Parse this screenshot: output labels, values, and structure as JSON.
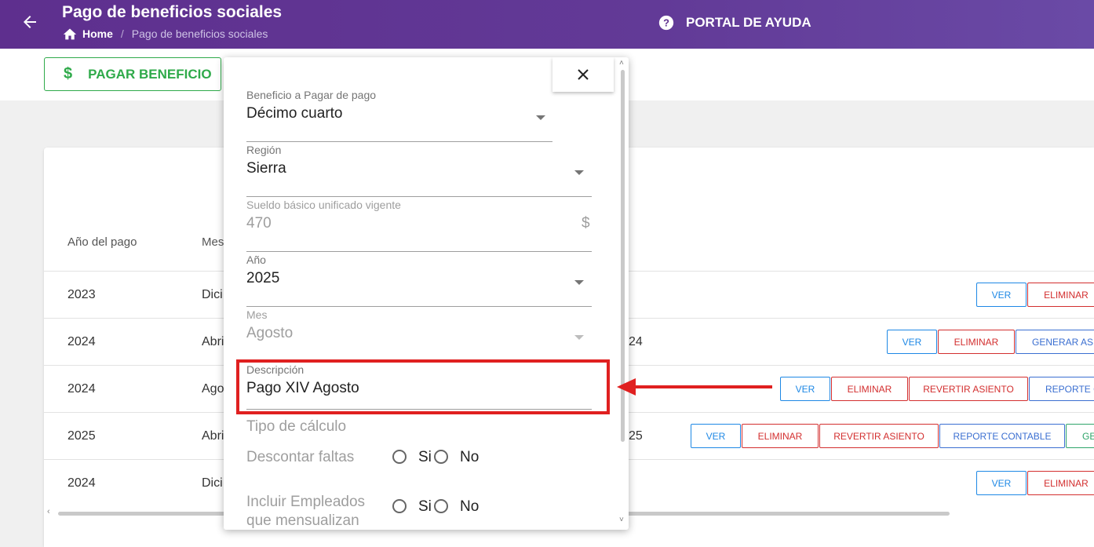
{
  "header": {
    "title": "Pago de beneficios sociales",
    "breadcrumb": {
      "home": "Home",
      "separator": "/",
      "current": "Pago de beneficios sociales"
    },
    "help_label": "PORTAL DE AYUDA"
  },
  "toolbar": {
    "pay_button": "PAGAR BENEFICIO",
    "pay_icon": "$"
  },
  "table": {
    "headers": {
      "year": "Año del pago",
      "month": "Mes"
    },
    "rows": [
      {
        "year": "2023",
        "month": "Dici",
        "extra": "",
        "actions": [
          "VER",
          "ELIMINAR"
        ]
      },
      {
        "year": "2024",
        "month": "Abril",
        "extra": "24",
        "actions": [
          "VER",
          "ELIMINAR",
          "GENERAR ASI"
        ]
      },
      {
        "year": "2024",
        "month": "Ago",
        "extra": "",
        "actions": [
          "VER",
          "ELIMINAR",
          "REVERTIR ASIENTO",
          "REPORTE C"
        ]
      },
      {
        "year": "2025",
        "month": "Abril",
        "extra": "25",
        "actions": [
          "VER",
          "ELIMINAR",
          "REVERTIR ASIENTO",
          "REPORTE CONTABLE",
          "GE"
        ]
      },
      {
        "year": "2024",
        "month": "Dici",
        "extra": "",
        "actions": [
          "VER",
          "ELIMINAR"
        ]
      }
    ]
  },
  "dialog": {
    "close_icon": "×",
    "fields": {
      "beneficio": {
        "label": "Beneficio a Pagar de pago",
        "value": "Décimo cuarto"
      },
      "region": {
        "label": "Región",
        "value": "Sierra"
      },
      "sueldo": {
        "label": "Sueldo básico unificado vigente",
        "value": "470",
        "suffix": "$"
      },
      "anio": {
        "label": "Año",
        "value": "2025"
      },
      "mes": {
        "label": "Mes",
        "value": "Agosto"
      },
      "descripcion": {
        "label": "Descripción",
        "value": "Pago XIV Agosto"
      }
    },
    "tipo_calculo": "Tipo de cálculo",
    "descontar_faltas": {
      "label": "Descontar faltas",
      "yes": "Si",
      "no": "No"
    },
    "incluir_empleados": {
      "label_line1": "Incluir Empleados",
      "label_line2": "que mensualizan",
      "yes": "Si",
      "no": "No"
    }
  },
  "colors": {
    "header_bg": "#5e2f8e",
    "accent_green": "#2faa4a",
    "danger": "#d32f2f",
    "primary": "#1e88e5",
    "annotation": "#e02020"
  }
}
